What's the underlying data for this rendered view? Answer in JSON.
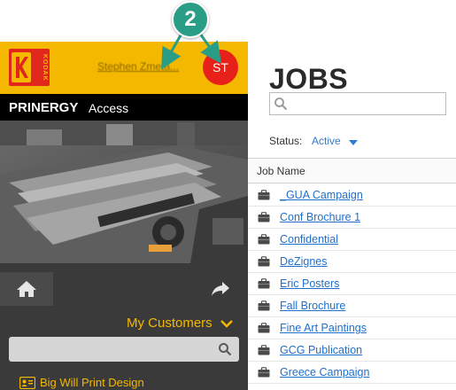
{
  "callout": {
    "number": "2",
    "color": "#2a9d86"
  },
  "header": {
    "brand_logo_text": "KODAK",
    "user_name": "Stephen Zmeta...",
    "avatar_initials": "ST",
    "brand_color": "#f5b800",
    "avatar_color": "#e8201a"
  },
  "app": {
    "title": "PRINERGY",
    "subtitle": "Access"
  },
  "nav": {
    "home_icon": "home-icon",
    "share_icon": "share-icon"
  },
  "customers": {
    "dropdown_label": "My Customers",
    "search_placeholder": "",
    "items": [
      {
        "label": "Big Will Print Design",
        "icon": "contact-card-icon"
      }
    ]
  },
  "jobs": {
    "title": "JOBS",
    "search_placeholder": "",
    "status_label": "Status:",
    "status_value": "Active",
    "column_header": "Job Name",
    "link_color": "#1f6fcb",
    "items": [
      "_GUA Campaign",
      "Conf Brochure 1",
      "Confidential",
      "DeZignes",
      "Eric Posters",
      "Fall Brochure",
      "Fine Art Paintings",
      "GCG Publication",
      "Greece Campaign"
    ]
  }
}
